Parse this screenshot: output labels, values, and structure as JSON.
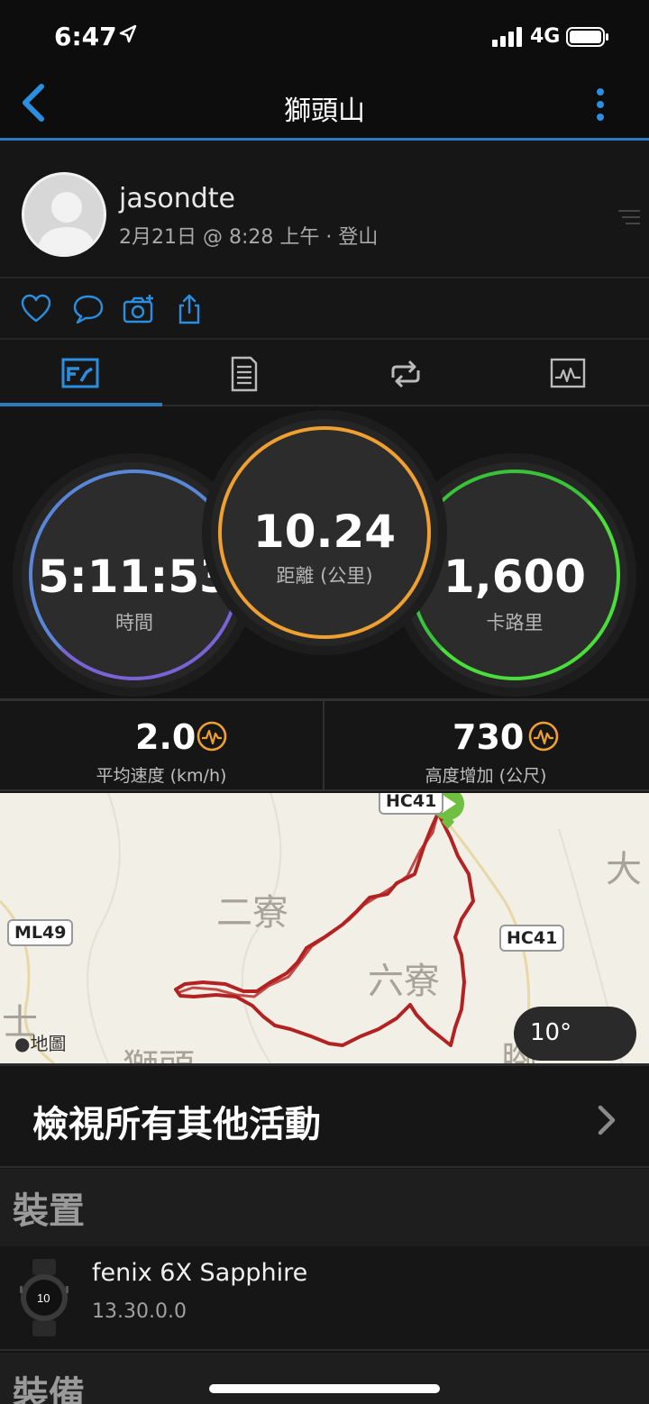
{
  "status_bar": {
    "time": "6:47",
    "network": "4G"
  },
  "nav": {
    "title": "獅頭山"
  },
  "profile": {
    "username": "jasondte",
    "meta": "2月21日 @ 8:28 上午 · 登山"
  },
  "rings": {
    "time": {
      "value": "5:11:53",
      "label": "時間",
      "color": "#7a63d6"
    },
    "distance": {
      "value": "10.24",
      "label": "距離 (公里)",
      "color": "#f0a030"
    },
    "calories": {
      "value": "1,600",
      "label": "卡路里",
      "color": "#4ade3a"
    }
  },
  "stats": {
    "avg_speed": {
      "value": "2.0",
      "label": "平均速度 (km/h)"
    },
    "elev_gain": {
      "value": "730",
      "label": "高度增加 (公尺)"
    }
  },
  "map": {
    "labels": [
      "二寮",
      "六寮",
      "大",
      "士",
      "獅頭",
      "腳"
    ],
    "shields": [
      "HC41",
      "ML49",
      "HC41"
    ],
    "weather": "10°",
    "attribution": "地圖",
    "route_color": "#b32222"
  },
  "view_all": {
    "label": "檢視所有其他活動"
  },
  "devices_section": {
    "label": "裝置"
  },
  "device": {
    "name": "fenix 6X Sapphire",
    "version": "13.30.0.0"
  },
  "gear_section": {
    "label": "裝備"
  },
  "accent": "#2b7bbd"
}
